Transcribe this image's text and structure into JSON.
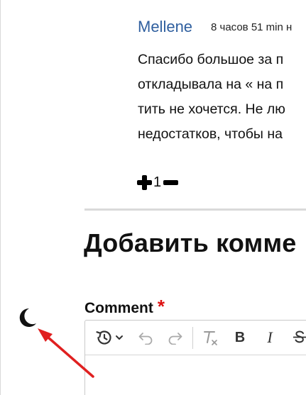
{
  "comment": {
    "author": "Mellene",
    "time": "8 часов 51 min н",
    "lines": [
      "Спасибо большое за п",
      "откладывала на « на п",
      "тить не хочется. Не лю",
      "недостатков, чтобы на"
    ],
    "votes": "1"
  },
  "form": {
    "title": "Добавить комме",
    "comment_label": "Comment",
    "required_mark": "*"
  },
  "toolbar": {
    "bold": "B",
    "italic": "I"
  },
  "icons": {
    "theme_toggle": "moon-icon",
    "annotation": "red-arrow-annotation"
  },
  "colors": {
    "author_link": "#2f5f9f",
    "required": "#dd1111",
    "annotation_arrow": "#e02020"
  }
}
